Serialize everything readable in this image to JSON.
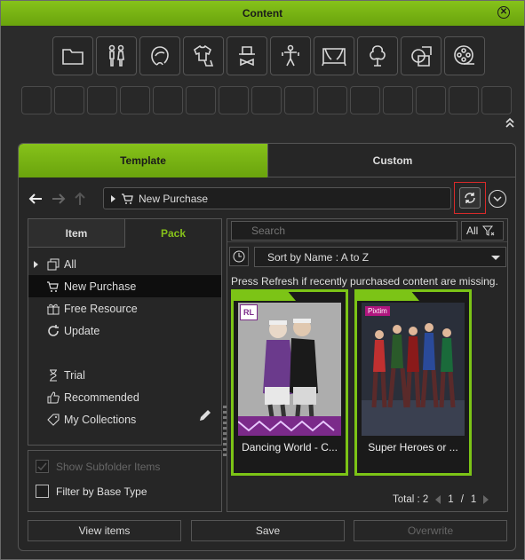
{
  "window": {
    "title": "Content"
  },
  "categories": [
    {
      "icon": "folder-icon"
    },
    {
      "icon": "characters-icon"
    },
    {
      "icon": "head-icon"
    },
    {
      "icon": "clothing-icon"
    },
    {
      "icon": "accessory-icon"
    },
    {
      "icon": "motion-icon"
    },
    {
      "icon": "stage-icon"
    },
    {
      "icon": "tree-icon"
    },
    {
      "icon": "shape-icon"
    },
    {
      "icon": "film-reel-icon"
    }
  ],
  "tabs": {
    "template": "Template",
    "custom": "Custom"
  },
  "breadcrumb": {
    "path": "New Purchase"
  },
  "subtabs": {
    "item": "Item",
    "pack": "Pack"
  },
  "tree": {
    "all": "All",
    "new_purchase": "New Purchase",
    "free_resource": "Free Resource",
    "update": "Update",
    "trial": "Trial",
    "recommended": "Recommended",
    "my_collections": "My Collections"
  },
  "options": {
    "show_subfolder": "Show Subfolder Items",
    "filter_base_type": "Filter by Base Type"
  },
  "search": {
    "placeholder": "Search",
    "filter": "All"
  },
  "sort": {
    "label": "Sort by Name : A to Z"
  },
  "hint": "Press Refresh if recently purchased content are missing.",
  "cards": [
    {
      "label": "Dancing World - C...",
      "badge": "RL"
    },
    {
      "label": "Super Heroes or ...",
      "badge": "Pixtim"
    }
  ],
  "pager": {
    "total": "Total : 2",
    "page": "1",
    "sep": "/",
    "pages": "1"
  },
  "buttons": {
    "view_items": "View items",
    "save": "Save",
    "overwrite": "Overwrite"
  },
  "colors": {
    "accent": "#7cc416",
    "highlight": "#d92a2a"
  }
}
